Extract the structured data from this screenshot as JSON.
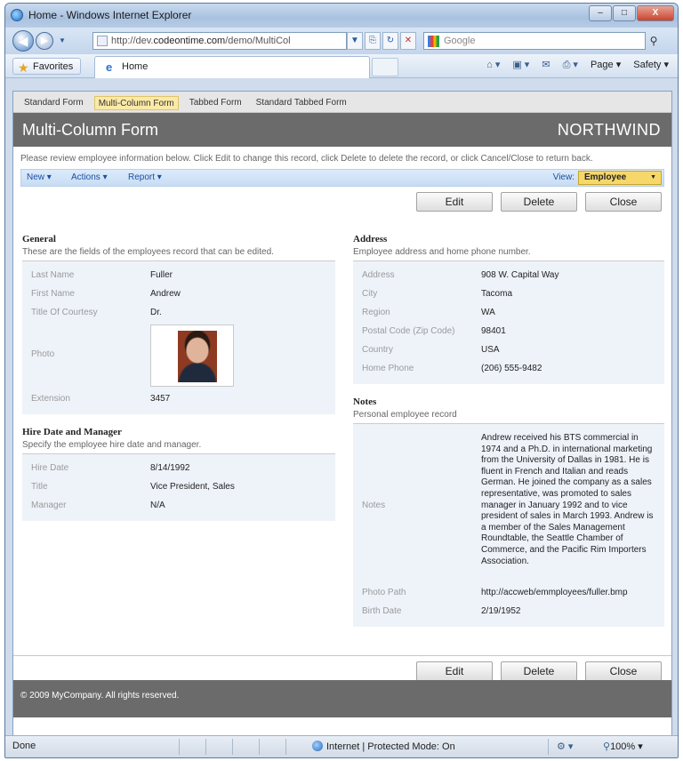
{
  "window": {
    "title": "Home - Windows Internet Explorer",
    "controls": [
      "–",
      "□",
      "X"
    ]
  },
  "address_bar": {
    "url_prefix": "http://dev.",
    "url_domain": "codeontime.com",
    "url_rest": "/demo/MultiCol",
    "search_placeholder": "Google"
  },
  "command_bar": {
    "favorites_label": "Favorites",
    "tab_label": "Home",
    "page_label": "Page ▾",
    "safety_label": "Safety ▾"
  },
  "page_tabs": [
    "Standard Form",
    "Multi-Column Form",
    "Tabbed Form",
    "Standard Tabbed Form"
  ],
  "header": {
    "title": "Multi-Column Form",
    "brand": "NORTHWIND"
  },
  "instructions": "Please review employee information below. Click Edit to change this record, click Delete to delete the record, or click Cancel/Close to return back.",
  "action_bar": {
    "new_label": "New ▾",
    "actions_label": "Actions ▾",
    "report_label": "Report ▾",
    "view_label": "View:",
    "view_value": "Employee"
  },
  "buttons": {
    "edit": "Edit",
    "delete": "Delete",
    "close": "Close"
  },
  "general": {
    "title": "General",
    "description": "These are the fields of the employees record that can be edited.",
    "fields": [
      {
        "label": "Last Name",
        "value": "Fuller"
      },
      {
        "label": "First Name",
        "value": "Andrew"
      },
      {
        "label": "Title Of Courtesy",
        "value": "Dr."
      },
      {
        "label": "Photo",
        "value": ""
      },
      {
        "label": "Extension",
        "value": "3457"
      }
    ]
  },
  "hire": {
    "title": "Hire Date and Manager",
    "description": "Specify the employee hire date and manager.",
    "fields": [
      {
        "label": "Hire Date",
        "value": "8/14/1992"
      },
      {
        "label": "Title",
        "value": "Vice President, Sales"
      },
      {
        "label": "Manager",
        "value": "N/A"
      }
    ]
  },
  "address": {
    "title": "Address",
    "description": "Employee address and home phone number.",
    "fields": [
      {
        "label": "Address",
        "value": "908 W. Capital Way"
      },
      {
        "label": "City",
        "value": "Tacoma"
      },
      {
        "label": "Region",
        "value": "WA"
      },
      {
        "label": "Postal Code (Zip Code)",
        "value": "98401"
      },
      {
        "label": "Country",
        "value": "USA"
      },
      {
        "label": "Home Phone",
        "value": "(206) 555-9482"
      }
    ]
  },
  "notes": {
    "title": "Notes",
    "description": "Personal employee record",
    "notes_label": "Notes",
    "notes_value": "Andrew received his BTS commercial in 1974 and a Ph.D. in international marketing from the University of Dallas in 1981. He is fluent in French and Italian and reads German. He joined the company as a sales representative, was promoted to sales manager in January 1992 and to vice president of sales in March 1993. Andrew is a member of the Sales Management Roundtable, the Seattle Chamber of Commerce, and the Pacific Rim Importers Association.",
    "photo_path_label": "Photo Path",
    "photo_path_value": "http://accweb/emmployees/fuller.bmp",
    "birth_date_label": "Birth Date",
    "birth_date_value": "2/19/1952"
  },
  "footer": "© 2009 MyCompany. All rights reserved.",
  "status_bar": {
    "status": "Done",
    "zone": "Internet | Protected Mode: On",
    "zoom": "100%"
  }
}
